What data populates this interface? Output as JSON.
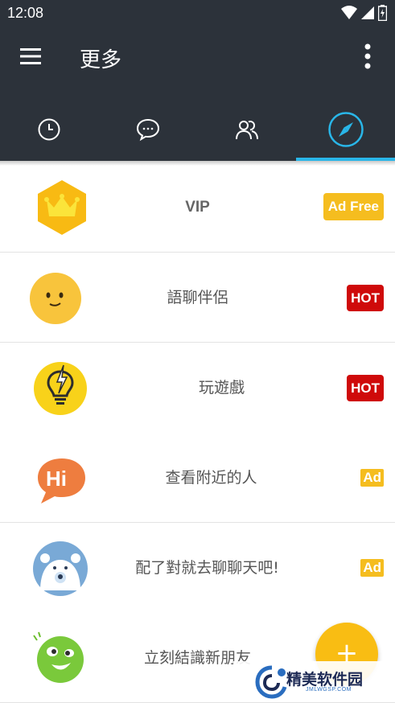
{
  "status_bar": {
    "time": "12:08",
    "icons": [
      "wifi-icon",
      "signal-icon",
      "battery-icon"
    ]
  },
  "app_bar": {
    "title": "更多",
    "menu_icon": "hamburger-menu-icon",
    "overflow_icon": "more-vert-icon"
  },
  "tabs": [
    {
      "icon": "clock-icon",
      "selected": false
    },
    {
      "icon": "chat-bubble-icon",
      "selected": false
    },
    {
      "icon": "people-icon",
      "selected": false
    },
    {
      "icon": "compass-icon",
      "selected": true
    }
  ],
  "accent_color": "#29b6e8",
  "items": [
    {
      "icon": "crown-icon",
      "label": "VIP",
      "badge": "Ad Free",
      "badge_type": "adfree"
    },
    {
      "icon": "smiley-face-icon",
      "label": "語聊伴侶",
      "badge": "HOT",
      "badge_type": "hot"
    },
    {
      "icon": "lightbulb-icon",
      "label": "玩遊戲",
      "badge": "HOT",
      "badge_type": "hot"
    },
    {
      "icon": "hi-speech-bubble-icon",
      "label": "查看附近的人",
      "badge": "Ad",
      "badge_type": "ad"
    },
    {
      "icon": "polar-bear-icon",
      "label": "配了對就去聊聊天吧!",
      "badge": "Ad",
      "badge_type": "ad"
    },
    {
      "icon": "green-monster-icon",
      "label": "立刻結識新朋友",
      "badge": "",
      "badge_type": "ad"
    }
  ],
  "fab": {
    "label": "+"
  },
  "watermark": {
    "text": "精美软件园",
    "sub": "JMLWGSP.COM"
  }
}
